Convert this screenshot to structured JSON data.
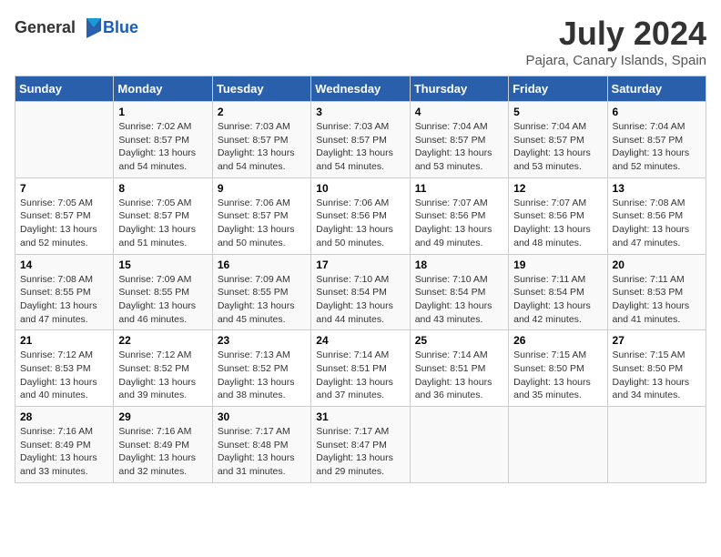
{
  "logo": {
    "general": "General",
    "blue": "Blue"
  },
  "title": "July 2024",
  "subtitle": "Pajara, Canary Islands, Spain",
  "days_of_week": [
    "Sunday",
    "Monday",
    "Tuesday",
    "Wednesday",
    "Thursday",
    "Friday",
    "Saturday"
  ],
  "weeks": [
    [
      {
        "day": "",
        "info": ""
      },
      {
        "day": "1",
        "info": "Sunrise: 7:02 AM\nSunset: 8:57 PM\nDaylight: 13 hours\nand 54 minutes."
      },
      {
        "day": "2",
        "info": "Sunrise: 7:03 AM\nSunset: 8:57 PM\nDaylight: 13 hours\nand 54 minutes."
      },
      {
        "day": "3",
        "info": "Sunrise: 7:03 AM\nSunset: 8:57 PM\nDaylight: 13 hours\nand 54 minutes."
      },
      {
        "day": "4",
        "info": "Sunrise: 7:04 AM\nSunset: 8:57 PM\nDaylight: 13 hours\nand 53 minutes."
      },
      {
        "day": "5",
        "info": "Sunrise: 7:04 AM\nSunset: 8:57 PM\nDaylight: 13 hours\nand 53 minutes."
      },
      {
        "day": "6",
        "info": "Sunrise: 7:04 AM\nSunset: 8:57 PM\nDaylight: 13 hours\nand 52 minutes."
      }
    ],
    [
      {
        "day": "7",
        "info": "Sunrise: 7:05 AM\nSunset: 8:57 PM\nDaylight: 13 hours\nand 52 minutes."
      },
      {
        "day": "8",
        "info": "Sunrise: 7:05 AM\nSunset: 8:57 PM\nDaylight: 13 hours\nand 51 minutes."
      },
      {
        "day": "9",
        "info": "Sunrise: 7:06 AM\nSunset: 8:57 PM\nDaylight: 13 hours\nand 50 minutes."
      },
      {
        "day": "10",
        "info": "Sunrise: 7:06 AM\nSunset: 8:56 PM\nDaylight: 13 hours\nand 50 minutes."
      },
      {
        "day": "11",
        "info": "Sunrise: 7:07 AM\nSunset: 8:56 PM\nDaylight: 13 hours\nand 49 minutes."
      },
      {
        "day": "12",
        "info": "Sunrise: 7:07 AM\nSunset: 8:56 PM\nDaylight: 13 hours\nand 48 minutes."
      },
      {
        "day": "13",
        "info": "Sunrise: 7:08 AM\nSunset: 8:56 PM\nDaylight: 13 hours\nand 47 minutes."
      }
    ],
    [
      {
        "day": "14",
        "info": "Sunrise: 7:08 AM\nSunset: 8:55 PM\nDaylight: 13 hours\nand 47 minutes."
      },
      {
        "day": "15",
        "info": "Sunrise: 7:09 AM\nSunset: 8:55 PM\nDaylight: 13 hours\nand 46 minutes."
      },
      {
        "day": "16",
        "info": "Sunrise: 7:09 AM\nSunset: 8:55 PM\nDaylight: 13 hours\nand 45 minutes."
      },
      {
        "day": "17",
        "info": "Sunrise: 7:10 AM\nSunset: 8:54 PM\nDaylight: 13 hours\nand 44 minutes."
      },
      {
        "day": "18",
        "info": "Sunrise: 7:10 AM\nSunset: 8:54 PM\nDaylight: 13 hours\nand 43 minutes."
      },
      {
        "day": "19",
        "info": "Sunrise: 7:11 AM\nSunset: 8:54 PM\nDaylight: 13 hours\nand 42 minutes."
      },
      {
        "day": "20",
        "info": "Sunrise: 7:11 AM\nSunset: 8:53 PM\nDaylight: 13 hours\nand 41 minutes."
      }
    ],
    [
      {
        "day": "21",
        "info": "Sunrise: 7:12 AM\nSunset: 8:53 PM\nDaylight: 13 hours\nand 40 minutes."
      },
      {
        "day": "22",
        "info": "Sunrise: 7:12 AM\nSunset: 8:52 PM\nDaylight: 13 hours\nand 39 minutes."
      },
      {
        "day": "23",
        "info": "Sunrise: 7:13 AM\nSunset: 8:52 PM\nDaylight: 13 hours\nand 38 minutes."
      },
      {
        "day": "24",
        "info": "Sunrise: 7:14 AM\nSunset: 8:51 PM\nDaylight: 13 hours\nand 37 minutes."
      },
      {
        "day": "25",
        "info": "Sunrise: 7:14 AM\nSunset: 8:51 PM\nDaylight: 13 hours\nand 36 minutes."
      },
      {
        "day": "26",
        "info": "Sunrise: 7:15 AM\nSunset: 8:50 PM\nDaylight: 13 hours\nand 35 minutes."
      },
      {
        "day": "27",
        "info": "Sunrise: 7:15 AM\nSunset: 8:50 PM\nDaylight: 13 hours\nand 34 minutes."
      }
    ],
    [
      {
        "day": "28",
        "info": "Sunrise: 7:16 AM\nSunset: 8:49 PM\nDaylight: 13 hours\nand 33 minutes."
      },
      {
        "day": "29",
        "info": "Sunrise: 7:16 AM\nSunset: 8:49 PM\nDaylight: 13 hours\nand 32 minutes."
      },
      {
        "day": "30",
        "info": "Sunrise: 7:17 AM\nSunset: 8:48 PM\nDaylight: 13 hours\nand 31 minutes."
      },
      {
        "day": "31",
        "info": "Sunrise: 7:17 AM\nSunset: 8:47 PM\nDaylight: 13 hours\nand 29 minutes."
      },
      {
        "day": "",
        "info": ""
      },
      {
        "day": "",
        "info": ""
      },
      {
        "day": "",
        "info": ""
      }
    ]
  ]
}
